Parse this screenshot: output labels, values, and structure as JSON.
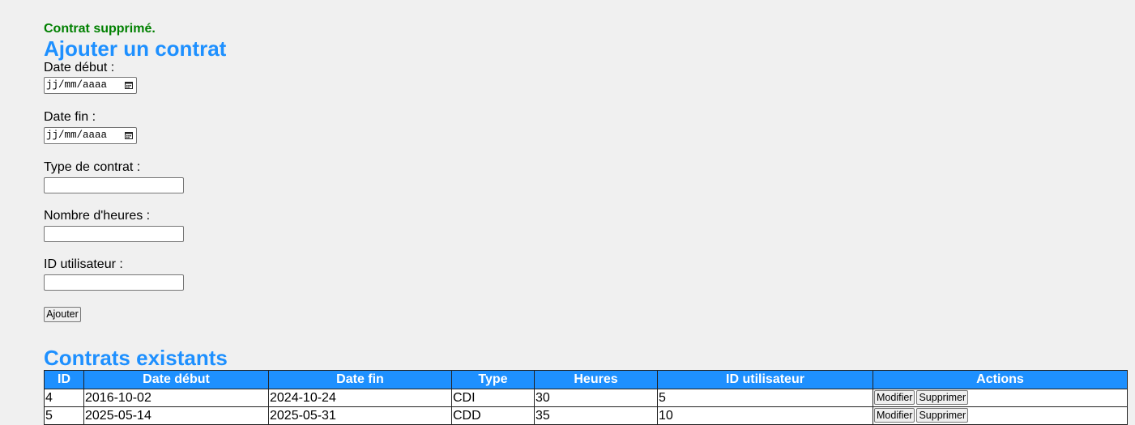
{
  "status_message": "Contrat supprimé.",
  "add_form": {
    "title": "Ajouter un contrat",
    "fields": [
      {
        "label": "Date début :",
        "placeholder": "jj/mm/aaaa",
        "icon": "calendar-icon"
      },
      {
        "label": "Date fin :",
        "placeholder": "jj/mm/aaaa",
        "icon": "calendar-icon"
      },
      {
        "label": "Type de contrat :",
        "value": ""
      },
      {
        "label": "Nombre d'heures :",
        "value": ""
      },
      {
        "label": "ID utilisateur :",
        "value": ""
      }
    ],
    "submit_label": "Ajouter"
  },
  "list": {
    "title": "Contrats existants",
    "columns": [
      "ID",
      "Date début",
      "Date fin",
      "Type",
      "Heures",
      "ID utilisateur",
      "Actions"
    ],
    "rows": [
      {
        "id": "4",
        "date_debut": "2016-10-02",
        "date_fin": "2024-10-24",
        "type": "CDI",
        "heures": "30",
        "id_utilisateur": "5"
      },
      {
        "id": "5",
        "date_debut": "2025-05-14",
        "date_fin": "2025-05-31",
        "type": "CDD",
        "heures": "35",
        "id_utilisateur": "10"
      }
    ],
    "edit_label": "Modifier",
    "delete_label": "Supprimer"
  },
  "colors": {
    "heading": "#1e90ff",
    "table_header_bg": "#1e90ff",
    "success_message": "#008000",
    "page_background": "#f0f0f0"
  }
}
